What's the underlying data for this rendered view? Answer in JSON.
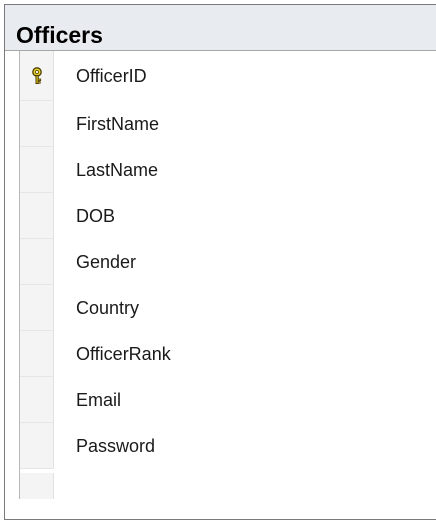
{
  "table": {
    "title": "Officers",
    "columns": [
      {
        "name": "OfficerID",
        "primary_key": true,
        "icon": "primary-key-icon"
      },
      {
        "name": "FirstName",
        "primary_key": false
      },
      {
        "name": "LastName",
        "primary_key": false
      },
      {
        "name": "DOB",
        "primary_key": false
      },
      {
        "name": "Gender",
        "primary_key": false
      },
      {
        "name": "Country",
        "primary_key": false
      },
      {
        "name": "OfficerRank",
        "primary_key": false
      },
      {
        "name": "Email",
        "primary_key": false
      },
      {
        "name": "Password",
        "primary_key": false
      }
    ]
  },
  "colors": {
    "header_bg": "#e8ebef",
    "border": "#7a7a7a",
    "key_icon": "#d4b800"
  }
}
